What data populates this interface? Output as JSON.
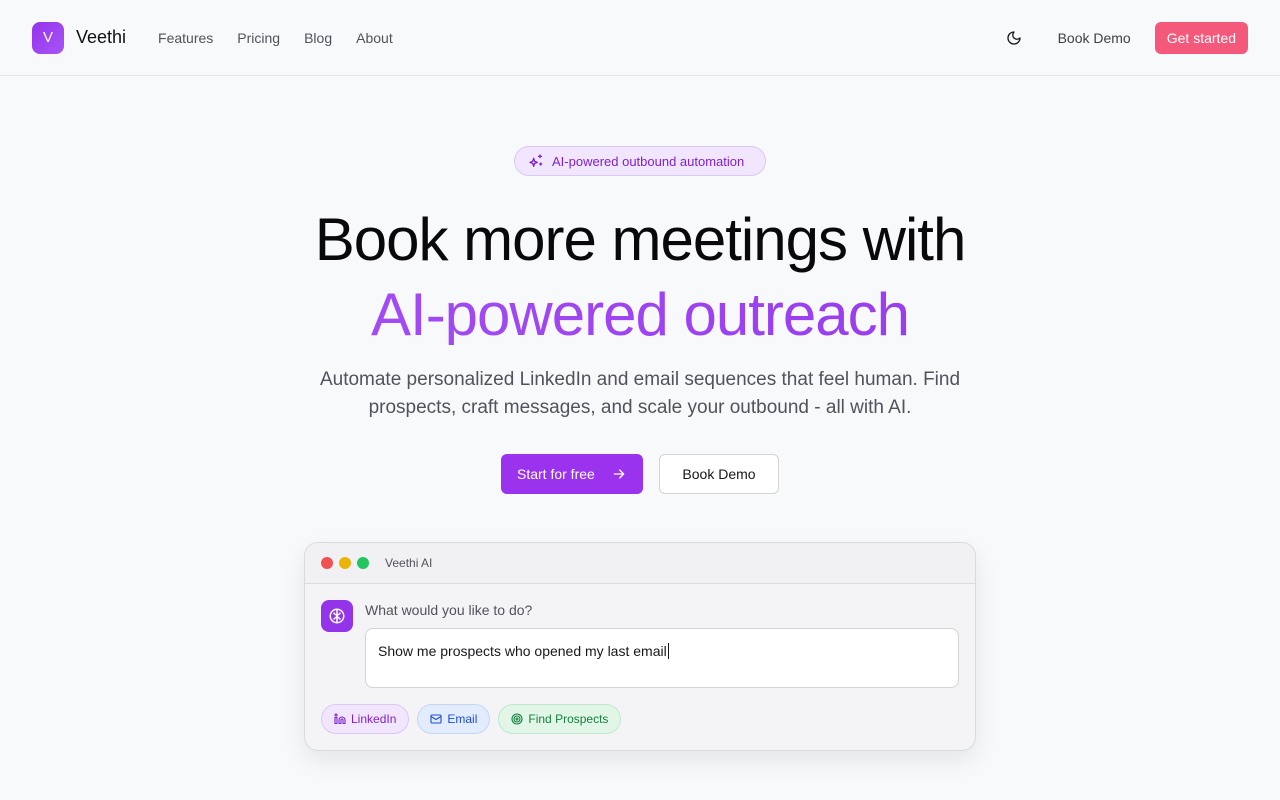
{
  "nav": {
    "logo_letter": "V",
    "brand": "Veethi",
    "links": [
      "Features",
      "Pricing",
      "Blog",
      "About"
    ],
    "theme_icon": "moon-icon",
    "book_demo": "Book Demo",
    "get_started": "Get started"
  },
  "hero": {
    "badge": "AI-powered outbound automation",
    "headline_1": "Book more meetings with",
    "headline_2": "AI-powered outreach",
    "subtitle": "Automate personalized LinkedIn and email sequences that feel human. Find prospects, craft messages, and scale your outbound - all with AI.",
    "primary_cta": "Start for free",
    "secondary_cta": "Book Demo"
  },
  "demo": {
    "window_title": "Veethi AI",
    "prompt_label": "What would you like to do?",
    "prompt_value": "Show me prospects who opened my last email",
    "chips": [
      "LinkedIn",
      "Email",
      "Find Prospects"
    ]
  },
  "colors": {
    "accent": "#9333ea",
    "cta": "#f4587a",
    "window_dots": [
      "#f05252",
      "#eab308",
      "#22c55e"
    ]
  }
}
